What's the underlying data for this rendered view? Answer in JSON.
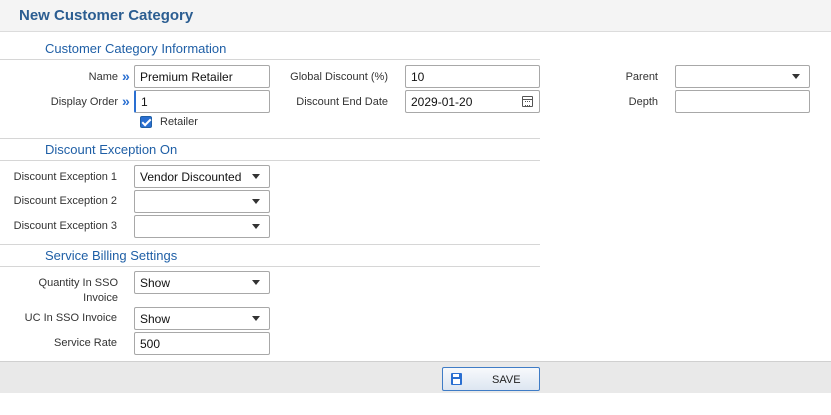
{
  "page": {
    "title": "New Customer Category"
  },
  "sections": {
    "info": "Customer Category Information",
    "discount": "Discount Exception On",
    "billing": "Service Billing Settings"
  },
  "info": {
    "name": {
      "label": "Name",
      "value": "Premium Retailer"
    },
    "display_order": {
      "label": "Display Order",
      "value": "1"
    },
    "retailer": {
      "label": "Retailer",
      "checked": true
    },
    "global_discount": {
      "label": "Global Discount (%)",
      "value": "10"
    },
    "discount_end_date": {
      "label": "Discount End Date",
      "value": "2029-01-20"
    },
    "parent": {
      "label": "Parent",
      "value": ""
    },
    "depth": {
      "label": "Depth",
      "value": ""
    }
  },
  "discount": {
    "exception_1": {
      "label": "Discount Exception 1",
      "value": "Vendor Discounted"
    },
    "exception_2": {
      "label": "Discount Exception 2",
      "value": ""
    },
    "exception_3": {
      "label": "Discount Exception 3",
      "value": ""
    }
  },
  "billing": {
    "quantity_in_sso": {
      "label": "Quantity In SSO Invoice",
      "value": "Show"
    },
    "uc_in_sso": {
      "label": "UC In SSO Invoice",
      "value": "Show"
    },
    "service_rate": {
      "label": "Service Rate",
      "value": "500"
    }
  },
  "footer": {
    "save_label": "SAVE"
  },
  "icons": {
    "required": "double-chevron-right-icon",
    "dropdown": "chevron-down-icon",
    "calendar": "calendar-icon",
    "save": "floppy-disk-icon"
  },
  "colors": {
    "accent": "#1f5fa6",
    "checkbox": "#2a6fd1",
    "header_bg": "#f4f4f4",
    "footer_bg": "#e9e9e9"
  }
}
